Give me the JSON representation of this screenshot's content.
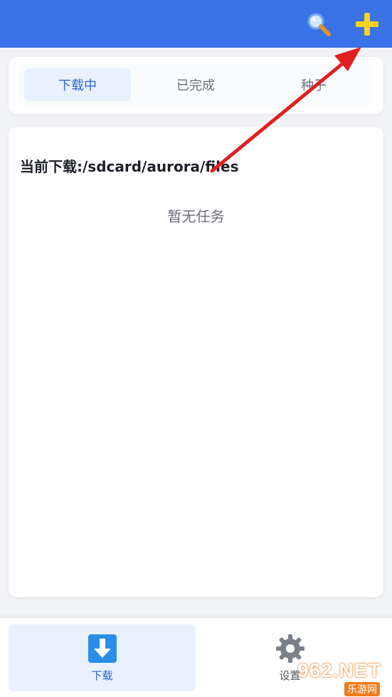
{
  "colors": {
    "header": "#3a72e8",
    "accent": "#3367d6",
    "plus": "#f7d21e"
  },
  "header": {
    "search_icon": "search-icon",
    "add_icon": "plus-icon"
  },
  "tabs": [
    {
      "label": "下载中",
      "active": true
    },
    {
      "label": "已完成",
      "active": false
    },
    {
      "label": "种子",
      "active": false
    }
  ],
  "main": {
    "path_label": "当前下载:/sdcard/aurora/files",
    "empty_text": "暂无任务"
  },
  "bottom_nav": [
    {
      "label": "下载",
      "icon": "download-icon",
      "active": true
    },
    {
      "label": "设置",
      "icon": "gear-icon",
      "active": false
    }
  ],
  "watermark": {
    "text": "962.NET",
    "sub": "乐游网"
  }
}
